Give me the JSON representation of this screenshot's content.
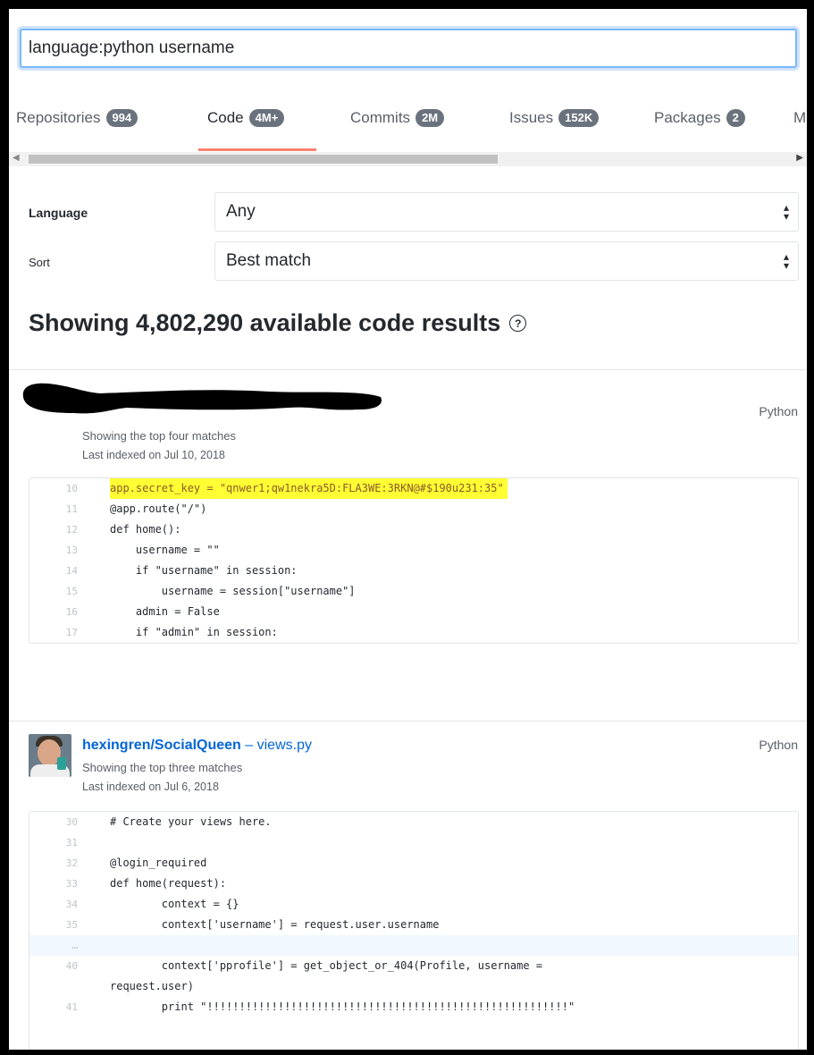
{
  "search": {
    "value": "language:python username"
  },
  "tabs": [
    {
      "label": "Repositories",
      "count": "994"
    },
    {
      "label": "Code",
      "count": "4M+"
    },
    {
      "label": "Commits",
      "count": "2M"
    },
    {
      "label": "Issues",
      "count": "152K"
    },
    {
      "label": "Packages",
      "count": "2"
    },
    {
      "label": "M",
      "count": ""
    }
  ],
  "filters": {
    "language_label": "Language",
    "language_value": "Any",
    "sort_label": "Sort",
    "sort_value": "Best match"
  },
  "results_heading": "Showing 4,802,290 available code results",
  "results": [
    {
      "repo": "",
      "file": "",
      "language": "Python",
      "matches_text": "Showing the top four matches",
      "indexed_text": "Last indexed on Jul 10, 2018",
      "lines": [
        {
          "n": "10",
          "text": "app.secret_key = \"qnwer1;qw1nekra5D:FLA3WE:3RKN@#$190u231:35\""
        },
        {
          "n": "11",
          "text": "@app.route(\"/\")"
        },
        {
          "n": "12",
          "text": "def home():"
        },
        {
          "n": "13",
          "text": "    username = \"\""
        },
        {
          "n": "14",
          "text": "    if \"username\" in session:"
        },
        {
          "n": "15",
          "text": "        username = session[\"username\"]"
        },
        {
          "n": "16",
          "text": "    admin = False"
        },
        {
          "n": "17",
          "text": "    if \"admin\" in session:"
        }
      ]
    },
    {
      "repo": "hexingren/SocialQueen",
      "file": "views.py",
      "separator": " – ",
      "language": "Python",
      "matches_text": "Showing the top three matches",
      "indexed_text": "Last indexed on Jul 6, 2018",
      "lines": [
        {
          "n": "30",
          "text": "# Create your views here."
        },
        {
          "n": "31",
          "text": ""
        },
        {
          "n": "32",
          "text": "@login_required"
        },
        {
          "n": "33",
          "text": "def home(request):"
        },
        {
          "n": "34",
          "text": "        context = {}"
        },
        {
          "n": "35",
          "text": "        context['username'] = request.user.username"
        },
        {
          "n": "…",
          "text": ""
        },
        {
          "n": "40",
          "text": "        context['pprofile'] = get_object_or_404(Profile, username =\nrequest.user)"
        },
        {
          "n": "41",
          "text": "        print \"!!!!!!!!!!!!!!!!!!!!!!!!!!!!!!!!!!!!!!!!!!!!!!!!!!!!!!!!\""
        }
      ]
    }
  ],
  "colors": {
    "highlight": "#ffff33",
    "link": "#0366d6",
    "tab_underline": "#f9826c",
    "counter": "#6a737d"
  },
  "icons": {
    "help": "question-circle-icon",
    "caret": "up-down-caret-icon"
  }
}
